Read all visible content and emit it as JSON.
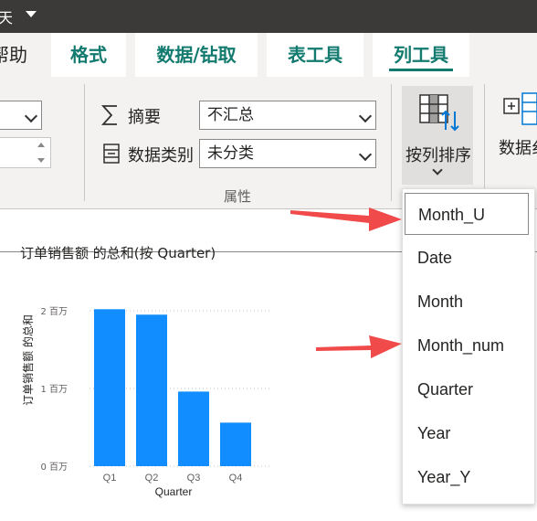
{
  "titlebar": {
    "title_fragment": "天"
  },
  "tabs": {
    "help": "帮助",
    "format": "格式",
    "data_drill": "数据/钻取",
    "table_tools": "表工具",
    "column_tools": "列工具"
  },
  "properties": {
    "summarization_label": "摘要",
    "summarization_value": "不汇总",
    "category_label": "数据类别",
    "category_value": "未分类",
    "group_label": "属性"
  },
  "sort": {
    "label": "按列排序",
    "group_label_fragment": "数据纟"
  },
  "chart_data": {
    "type": "bar",
    "title": "订单销售额 的总和(按 Quarter)",
    "xlabel": "Quarter",
    "ylabel": "订单销售额 的总和",
    "categories": [
      "Q1",
      "Q2",
      "Q3",
      "Q4"
    ],
    "values": [
      2.02,
      1.95,
      0.96,
      0.56
    ],
    "ylim": [
      0,
      2
    ],
    "yticks": [
      {
        "value": 0,
        "label": "0 百万"
      },
      {
        "value": 1,
        "label": "1 百万"
      },
      {
        "value": 2,
        "label": "2 百万"
      }
    ],
    "bar_color": "#118dff",
    "grid": true
  },
  "sort_menu": {
    "items": [
      "Month_U",
      "Date",
      "Month",
      "Month_num",
      "Quarter",
      "Year",
      "Year_Y"
    ]
  },
  "colors": {
    "accent": "#127a6e",
    "arrow": "#f03e3e",
    "bar": "#118dff"
  }
}
